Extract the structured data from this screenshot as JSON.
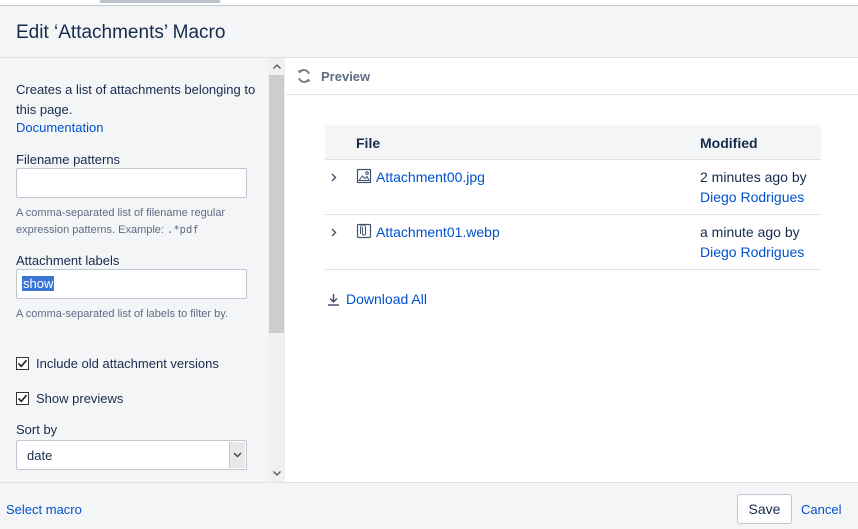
{
  "dialog": {
    "title": "Edit ‘Attachments’ Macro"
  },
  "left_panel": {
    "description": "Creates a list of attachments belonging to this page.",
    "documentation_link": "Documentation",
    "filename_patterns": {
      "label": "Filename patterns",
      "value": "",
      "hint_prefix": "A comma-separated list of filename regular expression patterns. Example: ",
      "hint_example": ".*pdf"
    },
    "attachment_labels": {
      "label": "Attachment labels",
      "value": "show",
      "hint": "A comma-separated list of labels to filter by."
    },
    "include_old_versions": {
      "label": "Include old attachment versions",
      "checked": true
    },
    "show_previews": {
      "label": "Show previews",
      "checked": true
    },
    "sort_by": {
      "label": "Sort by",
      "value": "date"
    }
  },
  "preview": {
    "title": "Preview",
    "columns": {
      "file": "File",
      "modified": "Modified"
    },
    "rows": [
      {
        "file": "Attachment00.jpg",
        "icon": "image-file-icon",
        "modified": "2 minutes ago by",
        "user": "Diego Rodrigues"
      },
      {
        "file": "Attachment01.webp",
        "icon": "attachment-file-icon",
        "modified": "a minute ago by",
        "user": "Diego Rodrigues"
      }
    ],
    "download_all": "Download All"
  },
  "footer": {
    "select_macro": "Select macro",
    "save": "Save",
    "cancel": "Cancel"
  },
  "colors": {
    "link": "#0052cc",
    "text": "#172b4d",
    "panel_bg": "#f4f5f7",
    "selection": "#3875d7"
  }
}
